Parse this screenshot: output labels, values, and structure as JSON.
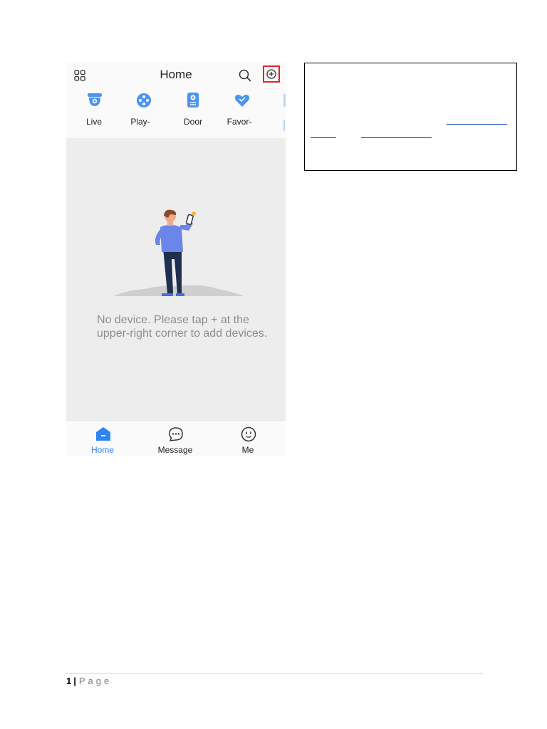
{
  "header": {
    "title": "Home"
  },
  "shortcuts": [
    {
      "label": "Live",
      "icon": "camera-icon"
    },
    {
      "label": "Play-",
      "icon": "playback-icon"
    },
    {
      "label": "Door",
      "icon": "door-intercom-icon"
    },
    {
      "label": "Favor-",
      "icon": "heart-icon"
    }
  ],
  "empty_state": {
    "message": "No device. Please tap + at the upper-right corner to add devices."
  },
  "tabs": [
    {
      "label": "Home",
      "icon": "home-icon",
      "active": true
    },
    {
      "label": "Message",
      "icon": "message-icon",
      "active": false
    },
    {
      "label": "Me",
      "icon": "me-icon",
      "active": false
    }
  ],
  "footer": {
    "page_number": "1",
    "separator": "|",
    "page_word": "Page"
  },
  "colors": {
    "accent": "#2f84f0",
    "highlight_box": "#e02424",
    "empty_text": "#8e8e8e"
  }
}
